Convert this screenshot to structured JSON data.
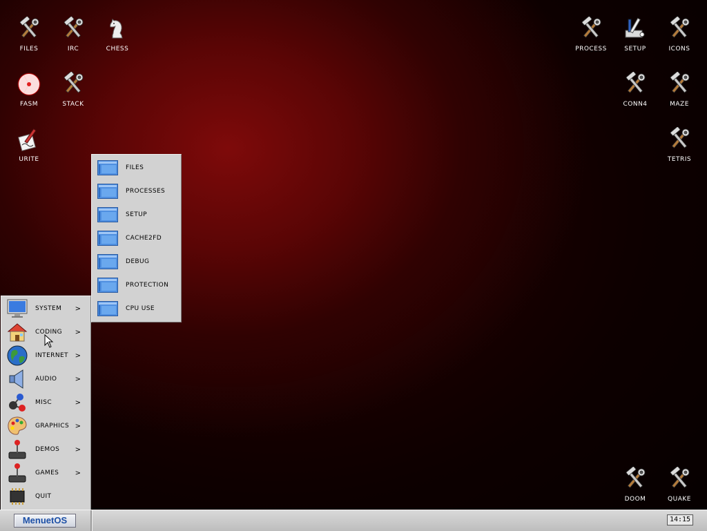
{
  "desktop": {
    "icons": {
      "files": "FILES",
      "irc": "IRC",
      "chess": "CHESS",
      "fasm": "FASM",
      "stack": "STACK",
      "write": "URITE",
      "process": "PROCESS",
      "setup": "SETUP",
      "icons": "ICONS",
      "conn4": "CONN4",
      "maze": "MAZE",
      "tetris": "TETRIS",
      "doom": "DOOM",
      "quake": "QUAKE"
    }
  },
  "main_menu": {
    "items": [
      {
        "label": "SYSTEM",
        "arrow": ">"
      },
      {
        "label": "CODING",
        "arrow": ">"
      },
      {
        "label": "INTERNET",
        "arrow": ">"
      },
      {
        "label": "AUDIO",
        "arrow": ">"
      },
      {
        "label": "MISC",
        "arrow": ">"
      },
      {
        "label": "GRAPHICS",
        "arrow": ">"
      },
      {
        "label": "DEMOS",
        "arrow": ">"
      },
      {
        "label": "GAMES",
        "arrow": ">"
      },
      {
        "label": "QUIT"
      }
    ]
  },
  "system_submenu": {
    "items": [
      "FILES",
      "PROCESSES",
      "SETUP",
      "CACHE2FD",
      "DEBUG",
      "PROTECTION",
      "CPU USE"
    ]
  },
  "taskbar": {
    "start_label": "MenuetOS",
    "clock": "14:15"
  },
  "colors": {
    "desktop_glow": "#7e0a0a",
    "menu_bg": "#d2d2d2",
    "start_text": "#1c4fa6"
  }
}
